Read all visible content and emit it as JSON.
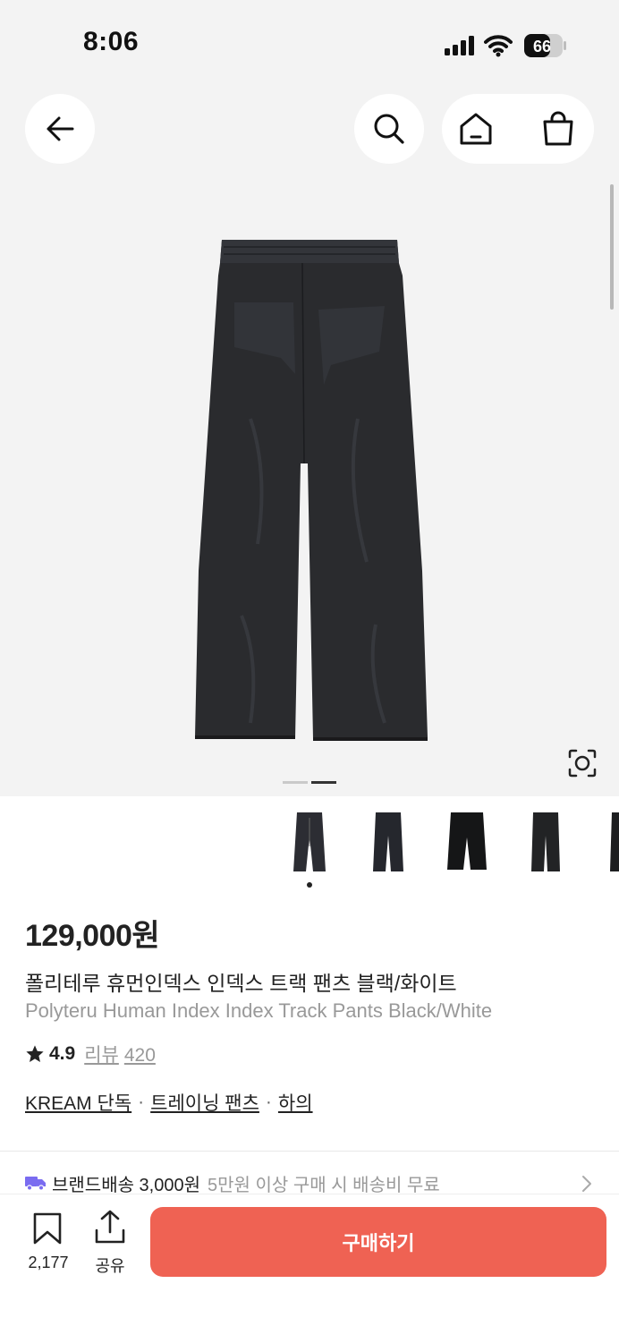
{
  "status_bar": {
    "time": "8:06",
    "battery": "66"
  },
  "icons": {
    "back": "arrow-left-icon",
    "search": "search-icon",
    "home": "home-icon",
    "cart": "shopping-bag-icon",
    "lens": "image-search-icon",
    "star": "star-icon",
    "truck": "truck-icon",
    "chevron": "chevron-right-icon",
    "bookmark": "bookmark-icon",
    "share": "share-icon"
  },
  "gallery": {
    "current_index": 2,
    "total": 2
  },
  "product": {
    "price": "129,000원",
    "name_ko": "폴리테루 휴먼인덱스 인덱스 트랙 팬츠 블랙/화이트",
    "name_en": "Polyteru Human Index Index Track Pants Black/White",
    "rating": "4.9",
    "review_label": "리뷰",
    "review_count": "420",
    "categories": [
      "KREAM 단독",
      "트레이닝 팬츠",
      "하의"
    ],
    "category_separator": "·"
  },
  "delivery": {
    "main": "브랜드배송 3,000원",
    "sub": "5만원 이상 구매 시 배송비 무료"
  },
  "bottom_bar": {
    "bookmark_count": "2,177",
    "share_label": "공유",
    "buy_label": "구매하기"
  },
  "colors": {
    "accent": "#ef6253",
    "truck": "#7a6cf0"
  }
}
